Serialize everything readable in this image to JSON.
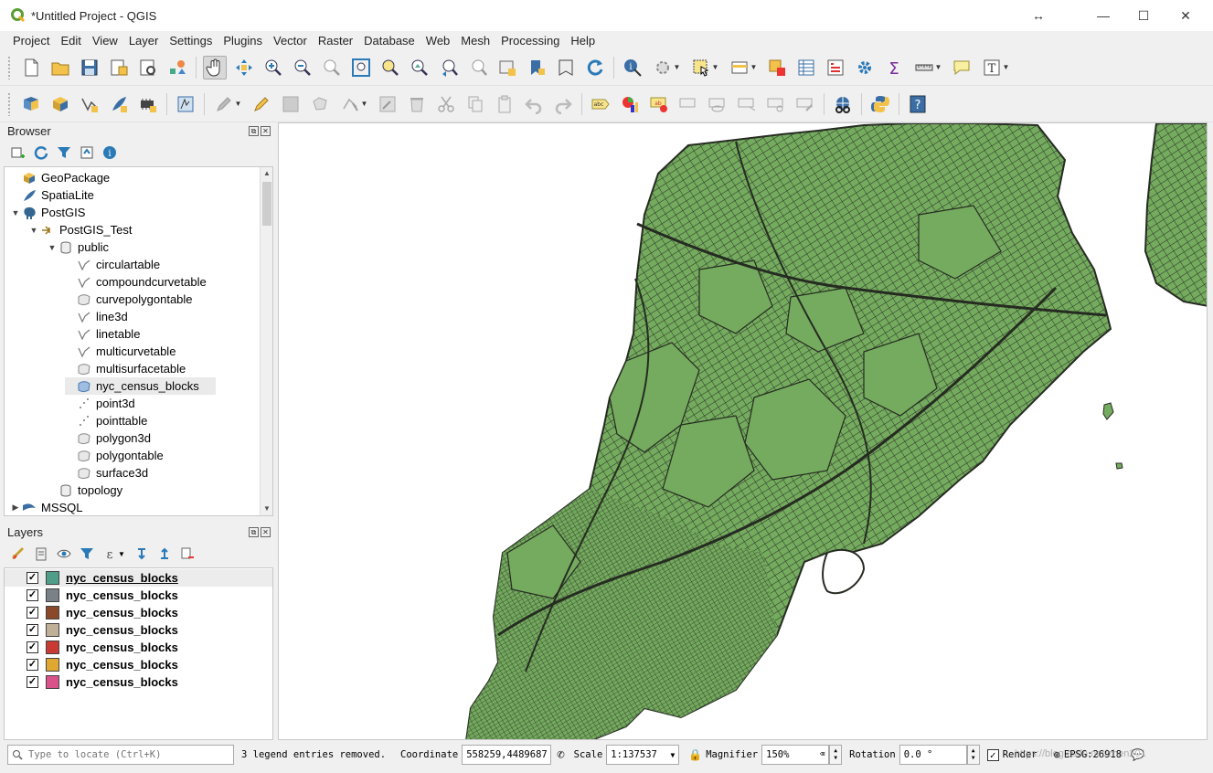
{
  "window": {
    "title": "*Untitled Project - QGIS",
    "resize_glyph": "↔",
    "minimize": "—",
    "maximize": "☐",
    "close": "✕"
  },
  "menubar": [
    "Project",
    "Edit",
    "View",
    "Layer",
    "Settings",
    "Plugins",
    "Vector",
    "Raster",
    "Database",
    "Web",
    "Mesh",
    "Processing",
    "Help"
  ],
  "browser": {
    "title": "Browser",
    "items": [
      {
        "label": "GeoPackage",
        "icon": "geopackage-icon",
        "arrow": ""
      },
      {
        "label": "SpatiaLite",
        "icon": "spatialite-icon",
        "arrow": ""
      },
      {
        "label": "PostGIS",
        "icon": "postgis-icon",
        "arrow": "▼"
      },
      {
        "label": "PostGIS_Test",
        "icon": "connection-icon",
        "arrow": "▼"
      },
      {
        "label": "public",
        "icon": "schema-icon",
        "arrow": "▼"
      },
      {
        "label": "circulartable",
        "icon": "line-layer-icon",
        "arrow": ""
      },
      {
        "label": "compoundcurvetable",
        "icon": "line-layer-icon",
        "arrow": ""
      },
      {
        "label": "curvepolygontable",
        "icon": "polygon-layer-icon",
        "arrow": ""
      },
      {
        "label": "line3d",
        "icon": "line-layer-icon",
        "arrow": ""
      },
      {
        "label": "linetable",
        "icon": "line-layer-icon",
        "arrow": ""
      },
      {
        "label": "multicurvetable",
        "icon": "line-layer-icon",
        "arrow": ""
      },
      {
        "label": "multisurfacetable",
        "icon": "polygon-layer-icon",
        "arrow": ""
      },
      {
        "label": "nyc_census_blocks",
        "icon": "polygon-layer-icon",
        "arrow": ""
      },
      {
        "label": "point3d",
        "icon": "point-layer-icon",
        "arrow": ""
      },
      {
        "label": "pointtable",
        "icon": "point-layer-icon",
        "arrow": ""
      },
      {
        "label": "polygon3d",
        "icon": "polygon-layer-icon",
        "arrow": ""
      },
      {
        "label": "polygontable",
        "icon": "polygon-layer-icon",
        "arrow": ""
      },
      {
        "label": "surface3d",
        "icon": "polygon-layer-icon",
        "arrow": ""
      },
      {
        "label": "topology",
        "icon": "schema-icon",
        "arrow": ""
      },
      {
        "label": "MSSQL",
        "icon": "mssql-icon",
        "arrow": "▶"
      }
    ]
  },
  "layers": {
    "title": "Layers",
    "items": [
      {
        "name": "nyc_census_blocks",
        "checked": "✓",
        "color": "#4f9e8a"
      },
      {
        "name": "nyc_census_blocks",
        "checked": "✓",
        "color": "#7a8288"
      },
      {
        "name": "nyc_census_blocks",
        "checked": "✓",
        "color": "#8a4a2a"
      },
      {
        "name": "nyc_census_blocks",
        "checked": "✓",
        "color": "#bfb098"
      },
      {
        "name": "nyc_census_blocks",
        "checked": "✓",
        "color": "#c83a32"
      },
      {
        "name": "nyc_census_blocks",
        "checked": "✓",
        "color": "#e0a830"
      },
      {
        "name": "nyc_census_blocks",
        "checked": "✓",
        "color": "#d9528a"
      }
    ]
  },
  "statusbar": {
    "locate_placeholder": "Type to locate (Ctrl+K)",
    "message": "3 legend entries removed.",
    "coordinate_label": "Coordinate",
    "coordinate_value": "558259,4489687",
    "scale_label": "Scale",
    "scale_value": "1:137537",
    "magnifier_label": "Magnifier",
    "magnifier_value": "150%",
    "rotation_label": "Rotation",
    "rotation_value": "0.0 °",
    "render_label": "Render",
    "crs_label": "EPSG:26918",
    "watermark": "https://blog.csdn.net/zhen201"
  },
  "map": {
    "fill_color": "#74ab5e",
    "stroke_color": "#262b22"
  }
}
